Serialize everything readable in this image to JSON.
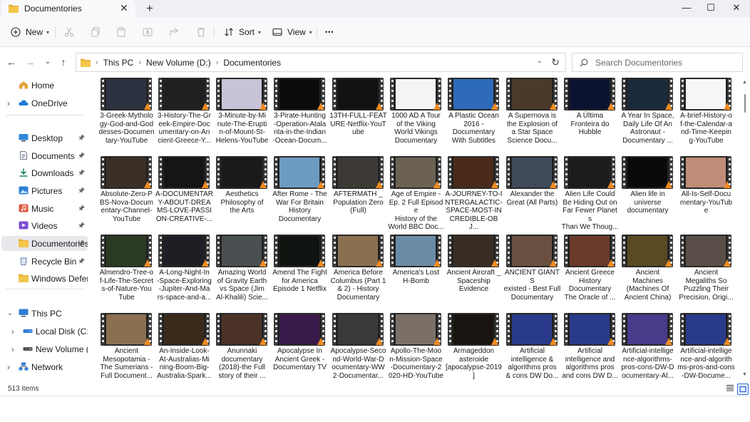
{
  "window": {
    "tab_title": "Documentories",
    "new_tab": "+",
    "minimize": "—",
    "maximize": "☐",
    "close": "✕"
  },
  "toolbar": {
    "new_label": "New",
    "sort_label": "Sort",
    "view_label": "View",
    "more_label": "•••"
  },
  "address": {
    "crumbs": [
      "This PC",
      "New Volume (D:)",
      "Documentories"
    ],
    "search_placeholder": "Search Documentories"
  },
  "sidebar": {
    "items": [
      {
        "label": "Home",
        "icon": "home-icon",
        "color": "#e2a33b"
      },
      {
        "label": "OneDrive",
        "icon": "cloud-icon",
        "color": "#1e7bd6"
      },
      {
        "label": "Desktop",
        "icon": "desktop-icon",
        "color": "#2f88d8"
      },
      {
        "label": "Documents",
        "icon": "documents-icon",
        "color": "#6f7a86"
      },
      {
        "label": "Downloads",
        "icon": "download-icon",
        "color": "#1f8a5c"
      },
      {
        "label": "Pictures",
        "icon": "pictures-icon",
        "color": "#2e7fd4"
      },
      {
        "label": "Music",
        "icon": "music-icon",
        "color": "#e0573b"
      },
      {
        "label": "Videos",
        "icon": "videos-icon",
        "color": "#7b4fd3"
      },
      {
        "label": "Documentories",
        "icon": "folder-icon",
        "color": "#e8b33a"
      },
      {
        "label": "Recycle Bin",
        "icon": "recycle-bin-icon",
        "color": "#5b7fa6"
      },
      {
        "label": "Windows Defend",
        "icon": "folder-icon",
        "color": "#e8b33a"
      },
      {
        "label": "This PC",
        "icon": "computer-icon",
        "color": "#2e7fd4"
      },
      {
        "label": "Local Disk (C:)",
        "icon": "drive-icon",
        "color": "#2e7fd4"
      },
      {
        "label": "New Volume (D:)",
        "icon": "drive-icon",
        "color": "#555555"
      },
      {
        "label": "Network",
        "icon": "network-icon",
        "color": "#2e7fd4"
      }
    ]
  },
  "files": [
    {
      "name": "3-Greek-Mythology-God-and-Goddesses-Documentary-YouTube",
      "display": "3-Greek-Mytholo\ngy-God-and-God\ndesses-Documen\ntary-YouTube",
      "bg": "#2c3140"
    },
    {
      "name": "3-History-The-Greek-Empire-Documentary-on-Ancient-Greece-Y...",
      "display": "3-History-The-Gr\neek-Empire-Doc\numentary-on-An\ncient-Greece-Y...",
      "bg": "#202020"
    },
    {
      "name": "3-Minute-by-Minute-The-Eruption-of-Mount-St-Helens-YouTube",
      "display": "3-Minute-by-Mi\nnute-The-Erupti\nn-of-Mount-St-\nHelens-YouTube",
      "bg": "#c9c3d8"
    },
    {
      "name": "3-Pirate-Hunting-Operation-Atalanta-in-the-Indian-Ocean-Docum...",
      "display": "3-Pirate-Hunting\n-Operation-Atala\nnta-in-the-Indian\n-Ocean-Docum...",
      "bg": "#0b0b0b"
    },
    {
      "name": "13TH-FULL-FEATURE-Netflix-YouTube",
      "display": "13TH-FULL-FEAT\nURE-Netflix-YouT\nube",
      "bg": "#111111"
    },
    {
      "name": "1000 AD A Tour of the Viking World Vikings Documentary",
      "display": "1000 AD A Tour\nof the Viking\nWorld Vikings\nDocumentary",
      "bg": "#f4f4f4"
    },
    {
      "name": "A Plastic Ocean 2016 - Documentary With Subtitles",
      "display": "A Plastic Ocean\n2016 -\nDocumentary\nWith Subtitles",
      "bg": "#2d6ab8"
    },
    {
      "name": "A Supernova is the Explosion of a Star Space Science Docu...",
      "display": "A Supernova is\nthe Explosion of\na Star Space\nScience Docu...",
      "bg": "#4a3a2a"
    },
    {
      "name": "A Última Fronteira do Hubble",
      "display": "A Última\nFronteira do\nHubble",
      "bg": "#0a1330"
    },
    {
      "name": "A Year In Space, Daily Life Of An Astronaut - Documentary ...",
      "display": "A Year In Space,\nDaily Life Of An\nAstronaut -\nDocumentary ...",
      "bg": "#1b2a3a"
    },
    {
      "name": "A-brief-History-of-the-Calendar-and-Time-Keeping-YouTube",
      "display": "A-brief-History-o\nf-the-Calendar-a\nnd-Time-Keepin\ng-YouTube",
      "bg": "#f6f6f6"
    },
    {
      "name": "Absolute-Zero-PBS-Nova-Documentary-Channel-YouTube",
      "display": "Absolute-Zero-P\nBS-Nova-Docum\nentary-Channel-\nYouTube",
      "bg": "#3a2e26"
    },
    {
      "name": "A-DOCUMENTARY-ABOUT-DREAMS-LOVE-PASSION-CREATIVE-...",
      "display": "A-DOCUMENTAR\nY-ABOUT-DREA\nMS-LOVE-PASSI\nON-CREATIVE-...",
      "bg": "#151515"
    },
    {
      "name": "Aesthetics Philosophy of the Arts",
      "display": "Aesthetics\nPhilosophy of\nthe Arts",
      "bg": "#1a1a1a"
    },
    {
      "name": "After Rome - The War For Britain History Documentary",
      "display": "After Rome - The\nWar For Britain\nHistory\nDocumentary",
      "bg": "#6e9bc2"
    },
    {
      "name": "AFTERMATH _ Population Zero (Full)",
      "display": "AFTERMATH _\nPopulation Zero\n(Full)",
      "bg": "#3d3a36"
    },
    {
      "name": "Age of Empire - Ep. 2 Full Episode History of the World BBC Doc...",
      "display": "Age of Empire -\nEp. 2 Full Episode\nHistory of the\nWorld BBC Doc...",
      "bg": "#6b6255"
    },
    {
      "name": "A-JOURNEY-TO-INTERGALACTIC-SPACE-MOST-INCREDIBLE-OBJ...",
      "display": "A-JOURNEY-TO-I\nNTERGALACTIC-\nSPACE-MOST-IN\nCREDIBLE-OBJ...",
      "bg": "#4a2a1a"
    },
    {
      "name": "Alexander the Great (All Parts)",
      "display": "Alexander the\nGreat (All Parts)",
      "bg": "#3e4a5a"
    },
    {
      "name": "Alien Life Could Be Hiding Out on Far Fewer Planets Than We Thoug...",
      "display": "Alien Life Could\nBe Hiding Out on\nFar Fewer Planets\nThan We Thoug...",
      "bg": "#1c1c1c"
    },
    {
      "name": "Alien life in universe documentary",
      "display": "Alien life in\nuniverse\ndocumentary",
      "bg": "#0a0a0a"
    },
    {
      "name": "All-Is-Self-Documentary-YouTube",
      "display": "All-Is-Self-Docu\nmentary-YouTub\ne",
      "bg": "#c08c78"
    },
    {
      "name": "Almendro-Tree-of-Life-The-Secrets-of-Nature-YouTube",
      "display": "Almendro-Tree-o\nf-Life-The-Secret\ns-of-Nature-You\nTube",
      "bg": "#2b3a22"
    },
    {
      "name": "A-Long-Night-In-Space-Exploring-Jupiter-And-Mars-space-and-a...",
      "display": "A-Long-Night-In\n-Space-Exploring\n-Jupiter-And-Ma\nrs-space-and-a...",
      "bg": "#1e1e24"
    },
    {
      "name": "Amazing World of Gravity Earth vs Space (Jim Al-Khalili) Scie...",
      "display": "Amazing World\nof Gravity Earth\nvs Space (Jim\nAl-Khalili) Scie...",
      "bg": "#4a4f52"
    },
    {
      "name": "Amend The Fight for America Episode 1 Netflix",
      "display": "Amend The Fight\nfor America\nEpisode 1 Netflix",
      "bg": "#101410"
    },
    {
      "name": "America Before Columbus (Part 1 & 2) - History Documentary",
      "display": "America Before\nColumbus (Part 1\n& 2) - History\nDocumentary",
      "bg": "#8a7050"
    },
    {
      "name": "America's Lost H-Bomb",
      "display": "America's Lost\nH-Bomb",
      "bg": "#6a8ca6"
    },
    {
      "name": "Ancient Aircraft _ Spaceship Evidence",
      "display": "Ancient Aircraft _\nSpaceship\nEvidence",
      "bg": "#3a2e24"
    },
    {
      "name": "ANCIENT GIANTS existed - Best Full Documentary",
      "display": "ANCIENT GIANTS\nexisted - Best Full\nDocumentary",
      "bg": "#6a5040"
    },
    {
      "name": "Ancient Greece History Documentary The Oracle of ...",
      "display": "Ancient Greece\nHistory\nDocumentary\nThe Oracle of ...",
      "bg": "#6a3a2a"
    },
    {
      "name": "Ancient Machines (Machines Of Ancient China)",
      "display": "Ancient\nMachines\n(Machines Of\nAncient China)",
      "bg": "#5a4a22"
    },
    {
      "name": "Ancient Megaliths So Puzzling Their Precision, Origi...",
      "display": "Ancient\nMegaliths So\nPuzzling Their\nPrecision, Origi...",
      "bg": "#5a4e48"
    },
    {
      "name": "Ancient Mesopotamia - The Sumerians - Full Document...",
      "display": "Ancient\nMesopotamia -\nThe Sumerians -\nFull Document...",
      "bg": "#8a7050"
    },
    {
      "name": "An-Inside-Look-At-Australias-Mining-Boom-Big-Australia-Spark...",
      "display": "An-Inside-Look-\nAt-Australias-Mi\nning-Boom-Big-\nAustralia-Spark...",
      "bg": "#3a2a1a"
    },
    {
      "name": "Anunnaki documentary (2018)-the Full story of their ...",
      "display": "Anunnaki\ndocumentary\n(2018)-the Full\nstory of their ...",
      "bg": "#4a3226"
    },
    {
      "name": "Apocalypse In Ancient Greek - Documentary TV",
      "display": "Apocalypse In\nAncient Greek -\nDocumentary TV",
      "bg": "#3a1a4a"
    },
    {
      "name": "Apocalypse-Second-World-War-Documentary-WW2-Documentar...",
      "display": "Apocalypse-Seco\nnd-World-War-D\nocumentary-WW\n2-Documentar...",
      "bg": "#3a3a3a"
    },
    {
      "name": "Apollo-The-Moon-Mission-Space-Documentary-2020-HD-YouTube",
      "display": "Apollo-The-Moo\nn-Mission-Space\n-Documentary-2\n020-HD-YouTube",
      "bg": "#7a7068"
    },
    {
      "name": "Armageddon asteroide [apocalypse-2019]",
      "display": "Armageddon\nasteroide\n[apocalypse-2019\n]",
      "bg": "#1a1410"
    },
    {
      "name": "Artificial intelligence & algorithms pros & cons DW Do...",
      "display": "Artificial\nintelligence &\nalgorithms pros\n& cons DW Do...",
      "bg": "#2a3a8a"
    },
    {
      "name": "Artificial intelligence and algorithms pros and cons DW D...",
      "display": "Artificial\nintelligence and\nalgorithms pros\nand cons DW D...",
      "bg": "#2a3a8a"
    },
    {
      "name": "Artificial-intelligence-algorithms-pros-cons-DW-Documentary-Al...",
      "display": "Artificial-intellige\nnce-algorithms-\npros-cons-DW-D\nocumentary-Al...",
      "bg": "#4a3a8a"
    },
    {
      "name": "Artificial-intelligence-and-algorithms-pros-and-cons-DW-Docume...",
      "display": "Artificial-intellige\nnce-and-algorith\nms-pros-and-cons\n-DW-Docume...",
      "bg": "#2a3a8a"
    }
  ],
  "status": {
    "item_count": "513 items"
  }
}
